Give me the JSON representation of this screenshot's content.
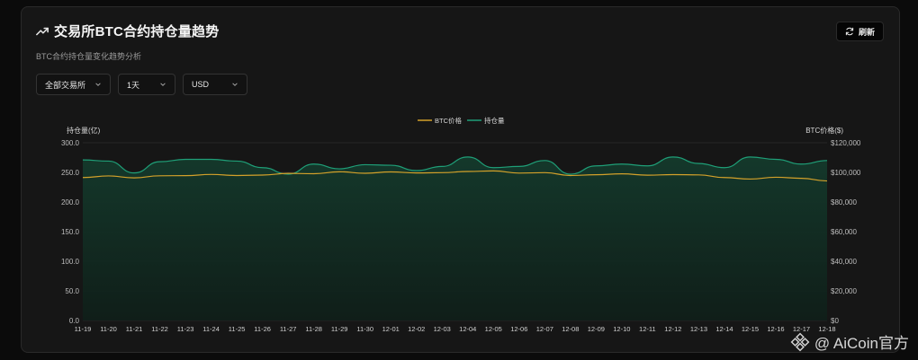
{
  "header": {
    "title": "交易所BTC合约持仓量趋势",
    "subtitle": "BTC合约持仓量变化趋势分析",
    "refresh_label": "刷新"
  },
  "filters": {
    "exchange": "全部交易所",
    "period": "1天",
    "currency": "USD"
  },
  "watermark": {
    "text": "@ AiCoin官方"
  },
  "colors": {
    "price_line": "#d4a12a",
    "oi_line": "#1f9f78",
    "oi_fill": "#143a2c"
  },
  "chart_data": {
    "type": "area",
    "legend": [
      "BTC价格",
      "持仓量"
    ],
    "legend_position": "top-center",
    "ylabel_left": "持仓量(亿)",
    "ylabel_right": "BTC价格($)",
    "ylim_left": [
      0,
      300
    ],
    "ylim_right": [
      0,
      120000
    ],
    "yticks_left": [
      "300.0",
      "250.0",
      "200.0",
      "150.0",
      "100.0",
      "50.0",
      "0.0"
    ],
    "yticks_right": [
      "$120,000",
      "$100,000",
      "$80,000",
      "$60,000",
      "$40,000",
      "$20,000",
      "$0"
    ],
    "grid": true,
    "x": [
      "11-19",
      "11-20",
      "11-21",
      "11-22",
      "11-23",
      "11-24",
      "11-25",
      "11-26",
      "11-27",
      "11-28",
      "11-29",
      "11-30",
      "12-01",
      "12-02",
      "12-03",
      "12-04",
      "12-05",
      "12-06",
      "12-07",
      "12-08",
      "12-09",
      "12-10",
      "12-11",
      "12-12",
      "12-13",
      "12-14",
      "12-15",
      "12-16",
      "12-17",
      "12-18"
    ],
    "series": [
      {
        "name": "持仓量",
        "axis": "left",
        "values": [
          271,
          269,
          249,
          268,
          272,
          272,
          269,
          258,
          247,
          264,
          256,
          263,
          262,
          253,
          260,
          276,
          258,
          260,
          270,
          247,
          261,
          264,
          261,
          276,
          265,
          258,
          276,
          272,
          264,
          270
        ]
      },
      {
        "name": "BTC价格",
        "axis": "right",
        "values": [
          96500,
          97600,
          96300,
          97700,
          97800,
          98600,
          97900,
          98200,
          99300,
          99100,
          100400,
          99400,
          100300,
          99600,
          99800,
          100600,
          101000,
          99500,
          99800,
          97900,
          98400,
          99000,
          98100,
          98500,
          98300,
          96500,
          95500,
          96700,
          96000,
          94200
        ]
      }
    ]
  }
}
